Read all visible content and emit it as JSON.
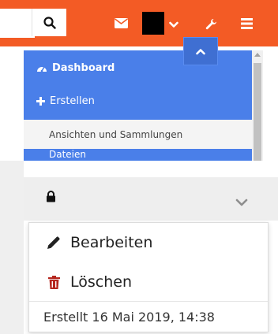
{
  "topbar": {
    "bg": "#f35b25",
    "search_icon": "search-icon",
    "mail_icon": "envelope-icon",
    "menu_icon": "hamburger-icon",
    "settings_icon": "wrench-icon"
  },
  "sidebar": {
    "bg": "#4a7fe9",
    "items": [
      {
        "label": "Dashboard",
        "icon": "dashboard-icon"
      },
      {
        "label": "Erstellen",
        "icon": "plus-icon"
      }
    ],
    "submenu_label": "Ansichten und Sammlungen",
    "partial_label": "Dateien"
  },
  "panel": {
    "lock_icon": "lock-icon",
    "toggle_icon": "chevron-down-icon"
  },
  "dropdown": {
    "edit_label": "Bearbeiten",
    "delete_label": "Löschen",
    "meta_text": "Erstellt 16 Mai 2019, 14:38",
    "delete_color": "#b5261e"
  }
}
